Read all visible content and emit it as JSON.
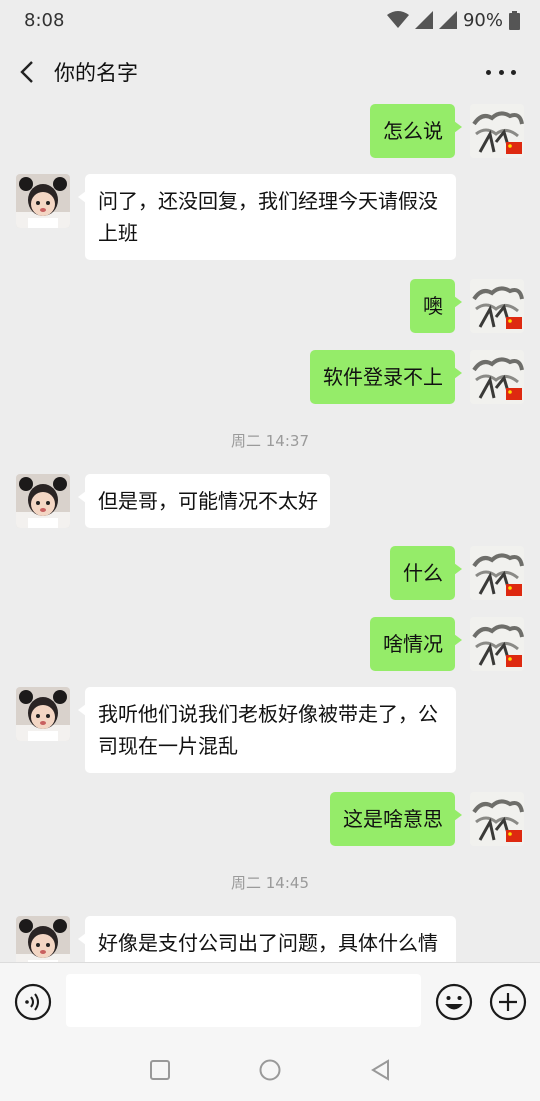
{
  "status_bar": {
    "time": "8:08",
    "battery": "90%"
  },
  "header": {
    "title": "你的名字"
  },
  "messages": {
    "m1": {
      "text": "怎么说"
    },
    "m2": {
      "text": "问了，还没回复，我们经理今天请假没上班"
    },
    "m3": {
      "text": "噢"
    },
    "m4": {
      "text": "软件登录不上"
    },
    "t1": {
      "text": "周二 14:37"
    },
    "m5": {
      "text": "但是哥，可能情况不太好"
    },
    "m6": {
      "text": "什么"
    },
    "m7": {
      "text": "啥情况"
    },
    "m8": {
      "text": "我听他们说我们老板好像被带走了，公司现在一片混乱"
    },
    "m9": {
      "text": "这是啥意思"
    },
    "t2": {
      "text": "周二 14:45"
    },
    "m10": {
      "text": "好像是支付公司出了问题，具体什么情况"
    }
  },
  "input": {
    "value": ""
  },
  "colors": {
    "bubble_out": "#95EC69",
    "bubble_in": "#FFFFFF",
    "background": "#EDEDED"
  },
  "icons": [
    "back-arrow-icon",
    "more-icon",
    "voice-icon",
    "emoji-icon",
    "plus-icon",
    "square-nav-icon",
    "circle-nav-icon",
    "triangle-nav-icon"
  ]
}
